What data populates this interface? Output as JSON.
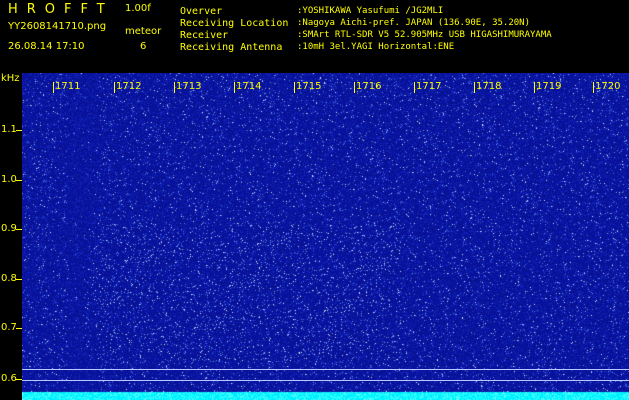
{
  "header": {
    "app_title": "HROFFT",
    "version": "1.00f",
    "filename": "YY2608141710.png",
    "mode": "meteor",
    "timestamp": "26.08.14 17:10",
    "meteor_count": "6",
    "info": [
      {
        "label": "Overver",
        "value": ":YOSHIKAWA Yasufumi /JG2MLI"
      },
      {
        "label": "Receiving Location",
        "value": ":Nagoya Aichi-pref. JAPAN (136.90E, 35.20N)"
      },
      {
        "label": "Receiver",
        "value": ":SMArt RTL-SDR V5 52.905MHz USB HIGASHIMURAYAMA"
      },
      {
        "label": "Receiving Antenna",
        "value": ":10mH 3el.YAGI Horizontal:ENE"
      }
    ]
  },
  "y_axis": {
    "unit": "kHz",
    "ticks": [
      "1.1",
      "1.0",
      "0.9",
      "0.8",
      "0.7",
      "0.6"
    ]
  },
  "x_axis": {
    "ticks": [
      "1711",
      "1712",
      "1713",
      "1714",
      "1715",
      "1716",
      "1717",
      "1718",
      "1719",
      "1720"
    ]
  },
  "colors": {
    "text": "#ffff00",
    "waterfall_bg": "#0a1496",
    "noise_floor": "#00e8ff"
  }
}
